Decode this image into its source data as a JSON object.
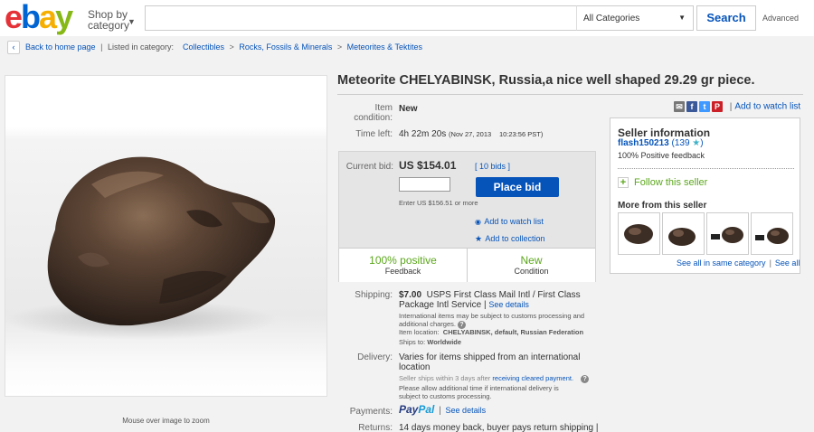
{
  "header": {
    "logo": [
      "e",
      "b",
      "a",
      "y"
    ],
    "shop_by_line1": "Shop by",
    "shop_by_line2": "category",
    "search_placeholder": "",
    "category_selected": "All Categories",
    "search_label": "Search",
    "advanced_label": "Advanced"
  },
  "breadcrumb": {
    "back_label": "Back to home page",
    "separator": "|",
    "listed_in": "Listed in category:",
    "items": [
      "Collectibles",
      "Rocks, Fossils & Minerals",
      "Meteorites & Tektites"
    ],
    "arrow": ">"
  },
  "image": {
    "caption": "Mouse over image to zoom"
  },
  "item": {
    "title": "Meteorite CHELYABINSK, Russia,a nice well shaped 29.29 gr piece.",
    "condition_label": "Item condition:",
    "condition_label_1": "Item",
    "condition_label_2": "condition:",
    "condition_value": "New",
    "time_left_label": "Time left:",
    "time_left_value": "4h 22m 20s",
    "time_left_date": "(Nov 27, 2013",
    "time_left_time": "10:23:56 PST)"
  },
  "share": {
    "watch_label": "Add to watch list",
    "separator": "|"
  },
  "bid": {
    "current_bid_label": "Current bid:",
    "current_bid_value": "US $154.01",
    "bids_count": "[ 10 bids ]",
    "bid_input_value": "",
    "place_bid_label": "Place bid",
    "enter_hint": "Enter US $156.51 or more",
    "add_watch": "Add to watch list",
    "add_collection": "Add to collection",
    "positive_big": "100% positive",
    "positive_small": "Feedback",
    "new_big": "New",
    "new_small": "Condition"
  },
  "seller": {
    "title": "Seller information",
    "name": "flash150213",
    "score": "(139",
    "score_close": ")",
    "feedback": "100% Positive feedback",
    "follow": "Follow this seller",
    "more_title": "More from this seller",
    "see_all_category": "See all in same category",
    "separator": "|",
    "see_all": "See all"
  },
  "shipping": {
    "label": "Shipping:",
    "price": "$7.00",
    "service_line1": "USPS First Class Mail Intl / First Class",
    "service_line2": "Package Intl Service",
    "see_details": "See details",
    "separator": "|",
    "note_line1": "International items may be subject to customs processing and",
    "note_line2": "additional charges.",
    "location_label": "Item location:",
    "location_value": "CHELYABINSK, default, Russian Federation",
    "ships_label": "Ships to:",
    "ships_value": "Worldwide"
  },
  "delivery": {
    "label": "Delivery:",
    "line1": "Varies for items shipped from an international",
    "line2": "location",
    "ships_within": "Seller ships within 3 days after",
    "cleared": "receiving cleared payment.",
    "allow_line1": "Please allow additional time if international delivery is",
    "allow_line2": "subject to customs processing."
  },
  "payments": {
    "label": "Payments:",
    "paypal_1": "Pay",
    "paypal_2": "Pal",
    "separator": "|",
    "see_details": "See details"
  },
  "returns": {
    "label": "Returns:",
    "value": "14 days money back, buyer pays return shipping |"
  },
  "colors": {
    "link": "#0654ba",
    "positive": "#5ba71b",
    "place_bid_bg": "#0654ba"
  }
}
